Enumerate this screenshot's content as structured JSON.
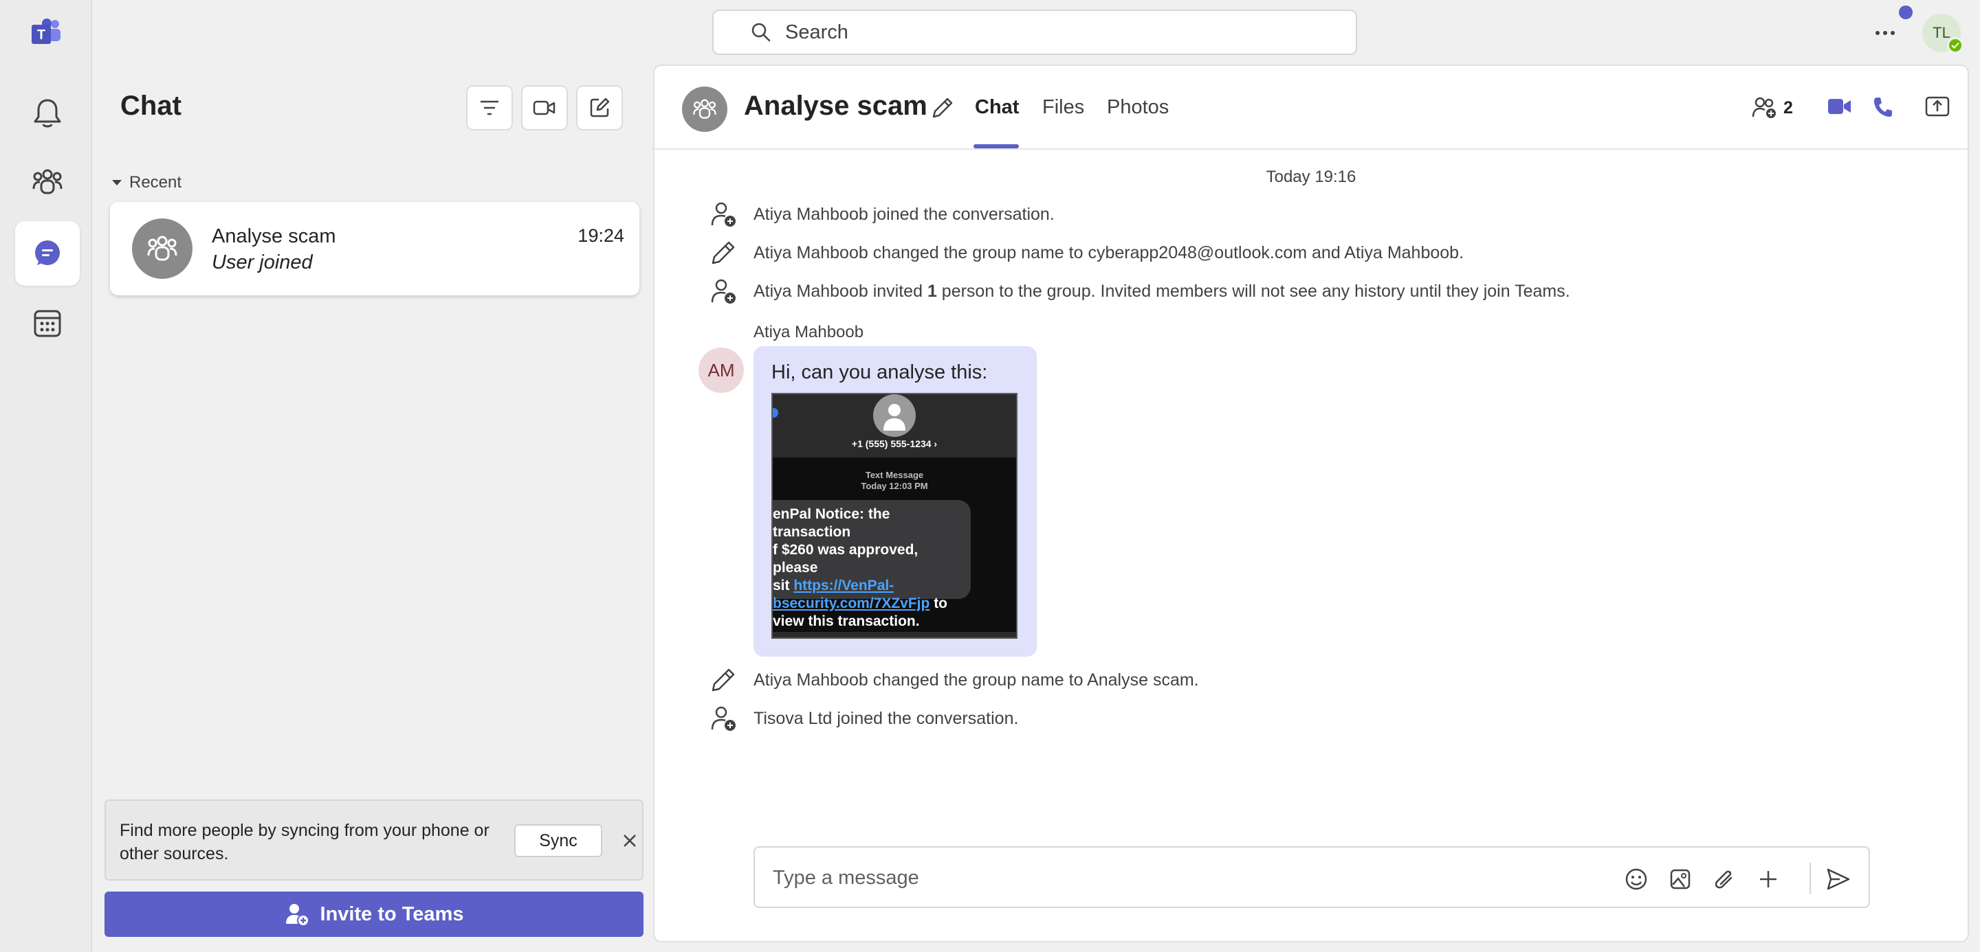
{
  "search": {
    "placeholder": "Search"
  },
  "account": {
    "initials": "TL"
  },
  "sidebar": {
    "title": "Chat",
    "recent_label": "Recent",
    "chats": [
      {
        "name": "Analyse scam",
        "preview": "User joined",
        "time": "19:24"
      }
    ]
  },
  "sync_banner": {
    "text": "Find more people by syncing from your phone or other sources.",
    "sync_label": "Sync"
  },
  "invite": {
    "label": "Invite to Teams"
  },
  "conversation": {
    "title": "Analyse scam",
    "tabs": [
      "Chat",
      "Files",
      "Photos"
    ],
    "participants_count": "2",
    "day_divider": "Today 19:16",
    "events_before": [
      {
        "icon": "person-add-icon",
        "text": "Atiya Mahboob joined the conversation."
      },
      {
        "icon": "pencil-icon",
        "text": "Atiya Mahboob changed the group name to cyberapp2048@outlook.com and Atiya Mahboob."
      },
      {
        "icon": "person-add-icon",
        "text_pre": "Atiya Mahboob invited ",
        "text_bold": "1",
        "text_post": " person to the group. Invited members will not see any history until they join Teams."
      }
    ],
    "message": {
      "sender": "Atiya Mahboob",
      "initials": "AM",
      "text": "Hi, can you analyse this:",
      "screenshot": {
        "number": "+1 (555) 555-1234 ›",
        "label_1": "Text Message",
        "label_2": "Today 12:03 PM",
        "line_1": "enPal Notice: the transaction",
        "line_2": "f $260 was approved, please",
        "line_3_pre": "sit ",
        "link_1": "https://VenPal-",
        "link_2": "bsecurity.com/7XZvFjp",
        "line_4_post": " to",
        "line_5": "view this transaction."
      }
    },
    "events_after": [
      {
        "icon": "pencil-icon",
        "text": "Atiya Mahboob changed the group name to Analyse scam."
      },
      {
        "icon": "person-add-icon",
        "text": "Tisova Ltd joined the conversation."
      }
    ],
    "composer_placeholder": "Type a message"
  },
  "colors": {
    "brand": "#5b5fc7",
    "bubble": "#e0e1fa",
    "presence": "#6bb700"
  }
}
